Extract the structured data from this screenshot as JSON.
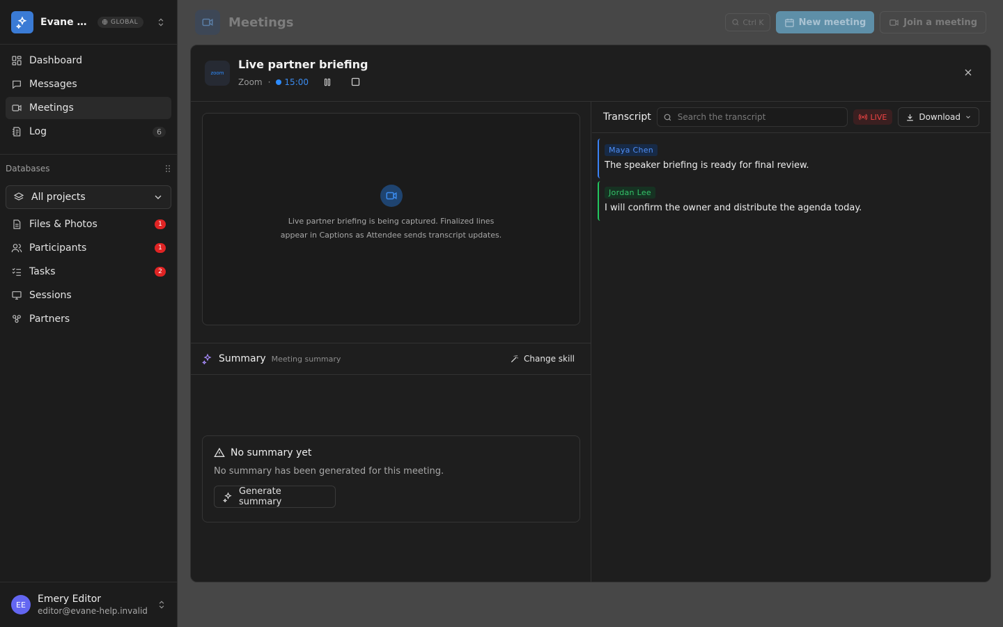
{
  "workspace": {
    "name": "Evane Help",
    "badge": "GLOBAL"
  },
  "nav": [
    {
      "label": "Dashboard",
      "icon": "dashboard-icon"
    },
    {
      "label": "Messages",
      "icon": "messages-icon"
    },
    {
      "label": "Meetings",
      "icon": "video-icon",
      "active": true
    },
    {
      "label": "Log",
      "icon": "log-icon",
      "count": "6"
    }
  ],
  "databases": {
    "heading": "Databases",
    "select_value": "All projects",
    "items": [
      {
        "label": "Files & Photos",
        "badge": "1"
      },
      {
        "label": "Participants",
        "badge": "1"
      },
      {
        "label": "Tasks",
        "badge": "2"
      },
      {
        "label": "Sessions"
      },
      {
        "label": "Partners"
      }
    ]
  },
  "user": {
    "initials": "EE",
    "name": "Emery Editor",
    "email": "editor@evane-help.invalid"
  },
  "header": {
    "title": "Meetings",
    "shortcut": "Ctrl K",
    "new_meeting": "New meeting",
    "join_meeting": "Join a meeting"
  },
  "meeting": {
    "title": "Live partner briefing",
    "provider": "Zoom",
    "provider_logo": "zoom",
    "timer": "15:00",
    "capture_message": "Live partner briefing is being captured. Finalized lines appear in Captions as Attendee sends transcript updates."
  },
  "summary": {
    "title": "Summary",
    "subtitle": "Meeting summary",
    "change_skill": "Change skill",
    "empty_title": "No summary yet",
    "empty_text": "No summary has been generated for this meeting.",
    "generate": "Generate summary"
  },
  "transcript": {
    "title": "Transcript",
    "search_placeholder": "Search the transcript",
    "live_label": "LIVE",
    "download": "Download",
    "entries": [
      {
        "speaker": "Maya Chen",
        "text": "The speaker briefing is ready for final review.",
        "color": "#3b82f6"
      },
      {
        "speaker": "Jordan Lee",
        "text": "I will confirm the owner and distribute the agenda today.",
        "color": "#22c55e"
      }
    ]
  },
  "colors": {
    "accent": "#3b8cf0",
    "live": "#ef4444",
    "badge": "#e02424"
  }
}
